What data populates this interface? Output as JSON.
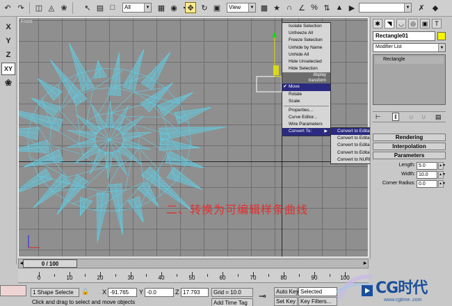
{
  "toolbar": {
    "selection_filter": "All",
    "reference_coord": "View",
    "named_selection": ""
  },
  "leftbar": {
    "axes": [
      "X",
      "Y",
      "Z",
      "XY"
    ]
  },
  "viewport": {
    "label": "Front",
    "caption": "二、转换为可编辑样条曲线",
    "wire_color": "#5fd3ec",
    "grid_color": "#6e6e6e"
  },
  "quad_menu": {
    "display_items": [
      "Isolate Selection",
      "Unfreeze All",
      "Freeze Selection",
      "Unhide by Name",
      "Unhide All",
      "Hide Unselected",
      "Hide Selection"
    ],
    "display_title": "display",
    "transform_title": "transform",
    "transform_items": [
      "Move",
      "Rotate",
      "Scale"
    ],
    "transform_items2": [
      "Properties...",
      "Curve Editor...",
      "Wire Parameters",
      "Convert To:"
    ],
    "submenu": [
      "Convert to Editable Spline",
      "Convert to Editable Mesh",
      "Convert to Editable Poly",
      "Convert to Editable Patch",
      "Convert to NURBS"
    ]
  },
  "command_panel": {
    "object_name": "Rectangle01",
    "modifier_list": "Modifier List",
    "stack_item": "Rectangle",
    "rollouts": [
      "Rendering",
      "Interpolation",
      "Parameters"
    ],
    "params": [
      {
        "label": "Length:",
        "value": "5.0"
      },
      {
        "label": "Width:",
        "value": "10.0"
      },
      {
        "label": "Corner Radius:",
        "value": "0.0"
      }
    ]
  },
  "timeline": {
    "current": "0 / 100",
    "ticks": [
      "0",
      "10",
      "20",
      "30",
      "40",
      "50",
      "60",
      "70",
      "80",
      "90",
      "100"
    ]
  },
  "status": {
    "selection": "1 Shape Selecte",
    "x_label": "X",
    "x": "-91.765",
    "y_label": "Y",
    "y": "-0.0",
    "z_label": "Z",
    "z": "17.793",
    "grid": "Grid = 10.0",
    "prompt": "Click and drag to select and move objects",
    "add_time_tag": "Add Time Tag",
    "auto_key": "Auto Key",
    "set_key": "Set Key",
    "key_mode": "Selected",
    "key_filters": "Key Filters..."
  },
  "watermark": {
    "brand": "CG时代",
    "url": "www.cgtime..com"
  }
}
